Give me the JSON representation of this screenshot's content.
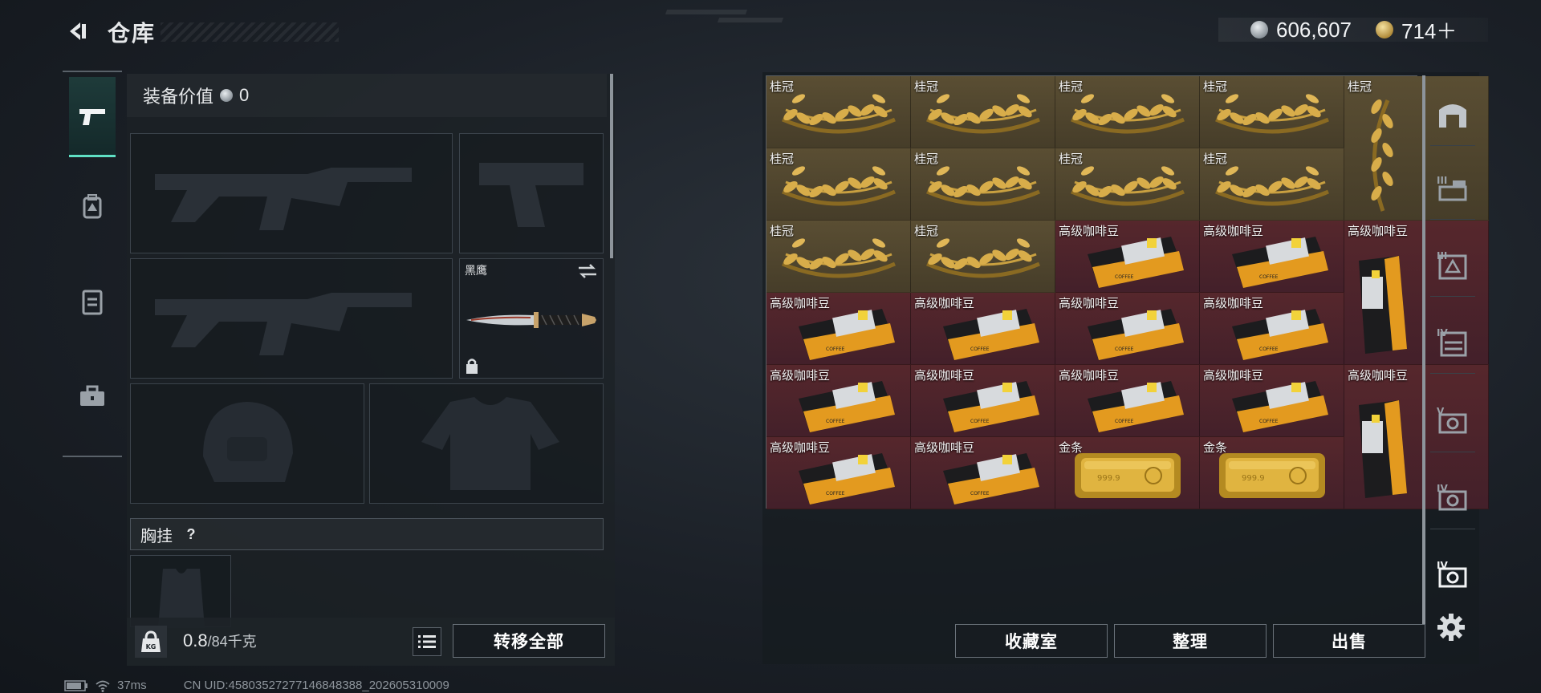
{
  "header": {
    "title": "仓库",
    "silver_value": "606,607",
    "gold_value": "714＋"
  },
  "equipment": {
    "value_label": "装备价值",
    "value": "0",
    "knife_name": "黑鹰",
    "vest_label": "胸挂",
    "vest_help": "?"
  },
  "footer_left": {
    "weight_value": "0.8",
    "weight_capacity": "/84千克",
    "weight_icon_text": "KG",
    "transfer_all_label": "转移全部"
  },
  "storage": {
    "items": [
      {
        "name": "桂冠",
        "type": "laurel"
      },
      {
        "name": "桂冠",
        "type": "laurel"
      },
      {
        "name": "桂冠",
        "type": "laurel"
      },
      {
        "name": "桂冠",
        "type": "laurel"
      },
      {
        "name": "桂冠",
        "type": "laurel-tall"
      },
      {
        "name": "桂冠",
        "type": "laurel"
      },
      {
        "name": "桂冠",
        "type": "laurel"
      },
      {
        "name": "桂冠",
        "type": "laurel"
      },
      {
        "name": "桂冠",
        "type": "laurel"
      },
      {
        "name": "桂冠",
        "type": "laurel"
      },
      {
        "name": "桂冠",
        "type": "laurel"
      },
      {
        "name": "高级咖啡豆",
        "type": "coffee"
      },
      {
        "name": "高级咖啡豆",
        "type": "coffee"
      },
      {
        "name": "高级咖啡豆",
        "type": "coffee-tall"
      },
      {
        "name": "高级咖啡豆",
        "type": "coffee"
      },
      {
        "name": "高级咖啡豆",
        "type": "coffee"
      },
      {
        "name": "高级咖啡豆",
        "type": "coffee"
      },
      {
        "name": "高级咖啡豆",
        "type": "coffee"
      },
      {
        "name": "高级咖啡豆",
        "type": "coffee"
      },
      {
        "name": "高级咖啡豆",
        "type": "coffee"
      },
      {
        "name": "高级咖啡豆",
        "type": "coffee"
      },
      {
        "name": "高级咖啡豆",
        "type": "coffee"
      },
      {
        "name": "高级咖啡豆",
        "type": "coffee-tall"
      },
      {
        "name": "高级咖啡豆",
        "type": "coffee"
      },
      {
        "name": "高级咖啡豆",
        "type": "coffee"
      },
      {
        "name": "金条",
        "type": "gold-bar"
      },
      {
        "name": "金条",
        "type": "gold-bar"
      }
    ],
    "buttons": {
      "collection": "收藏室",
      "organize": "整理",
      "sell": "出售"
    },
    "tabs": [
      "",
      "III",
      "III",
      "IV",
      "V",
      "IV",
      "IV"
    ]
  },
  "status": {
    "ping": "37ms",
    "uid": "CN UID:4580352727714684838​8_202605310009"
  },
  "colors": {
    "accent": "#5fe0c4",
    "gold_cell": "#4f4530",
    "red_cell": "#4d232a"
  }
}
